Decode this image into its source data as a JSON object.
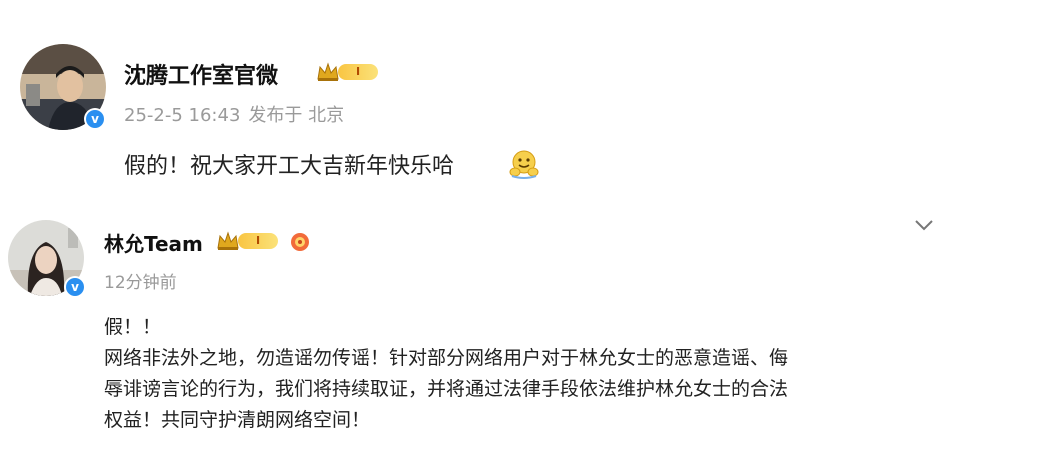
{
  "posts": [
    {
      "author": "沈腾工作室官微",
      "vip_level": "I",
      "timestamp": "25-2-5 16:43",
      "location": "发布于 北京",
      "text": "假的！祝大家开工大吉新年快乐哈",
      "emoji": "hug-emoji"
    },
    {
      "author": "林允Team",
      "vip_level": "I",
      "timestamp": "12分钟前",
      "lines": [
        "假！！",
        "网络非法外之地，勿造谣勿传谣！针对部分网络用户对于林允女士的恶意造谣、侮",
        "辱诽谤言论的行为，我们将持续取证，并将通过法律手段依法维护林允女士的合法",
        "权益！共同守护清朗网络空间！"
      ]
    }
  ],
  "colors": {
    "verified_blue": "#2a8ff0",
    "vip_gold": "#f9c542",
    "meta_gray": "#9a9a9a"
  }
}
